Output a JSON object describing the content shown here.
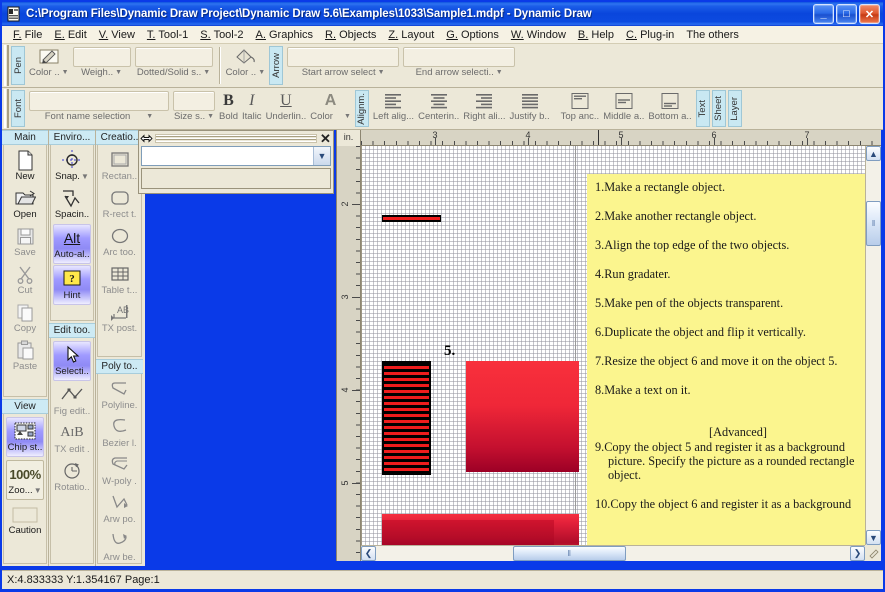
{
  "window": {
    "title": "C:\\Program Files\\Dynamic Draw Project\\Dynamic Draw 5.6\\Examples\\1033\\Sample1.mdpf - Dynamic Draw",
    "app_icon": "document-app-icon",
    "minimize": "_",
    "maximize": "□",
    "close": "✕"
  },
  "menubar": [
    {
      "accel": "F.",
      "label": "File"
    },
    {
      "accel": "E.",
      "label": "Edit"
    },
    {
      "accel": "V.",
      "label": "View"
    },
    {
      "accel": "T.",
      "label": "Tool-1"
    },
    {
      "accel": "S.",
      "label": "Tool-2"
    },
    {
      "accel": "A.",
      "label": "Graphics"
    },
    {
      "accel": "R.",
      "label": "Objects"
    },
    {
      "accel": "Z.",
      "label": "Layout"
    },
    {
      "accel": "G.",
      "label": "Options"
    },
    {
      "accel": "W.",
      "label": "Window"
    },
    {
      "accel": "B.",
      "label": "Help"
    },
    {
      "accel": "C.",
      "label": "Plug-in"
    },
    {
      "accel": "",
      "label": "The others"
    }
  ],
  "toolbar_pen": {
    "tab": "Pen",
    "items": [
      {
        "label": "Color ..",
        "icon": "pencil-icon",
        "dropdown": true
      },
      {
        "label": "Weigh..",
        "icon": "combo-box",
        "dropdown": true
      },
      {
        "label": "Dotted/Solid s..",
        "icon": "combo-box",
        "dropdown": true
      }
    ],
    "fill": {
      "label": "Color ..",
      "icon": "paint-bucket-icon",
      "dropdown": true
    }
  },
  "toolbar_arrow": {
    "tab": "Arrow",
    "items": [
      {
        "label": "Start arrow select",
        "icon": "combo-box",
        "dropdown": true
      },
      {
        "label": "End arrow selecti..",
        "icon": "combo-box",
        "dropdown": true
      }
    ]
  },
  "toolbar_font": {
    "tab": "Font",
    "name_label": "Font name selection",
    "size_label": "Size s..",
    "items": [
      {
        "label": "Bold",
        "glyph": "B",
        "style": "bold"
      },
      {
        "label": "Italic",
        "glyph": "I",
        "style": "italic"
      },
      {
        "label": "Underlin..",
        "glyph": "U",
        "style": "underline"
      },
      {
        "label": "Color",
        "glyph": "A",
        "dropdown": true
      }
    ]
  },
  "toolbar_align": {
    "tab": "Alignm.",
    "items": [
      {
        "label": "Left alig...",
        "icon": "align-left-icon"
      },
      {
        "label": "Centerin..",
        "icon": "align-center-icon"
      },
      {
        "label": "Right ali...",
        "icon": "align-right-icon"
      },
      {
        "label": "Justify b..",
        "icon": "align-justify-icon"
      },
      {
        "label": "Top anc..",
        "icon": "anchor-top-icon"
      },
      {
        "label": "Middle a..",
        "icon": "anchor-middle-icon"
      },
      {
        "label": "Bottom a..",
        "icon": "anchor-bottom-icon"
      }
    ],
    "tabs_right": [
      "Text",
      "Sheet",
      "Layer"
    ]
  },
  "dock": {
    "columns": [
      {
        "header": "Main",
        "items": [
          {
            "label": "New",
            "icon": "new-document-icon",
            "enabled": true
          },
          {
            "label": "Open",
            "icon": "open-folder-icon",
            "enabled": true
          },
          {
            "label": "Save",
            "icon": "floppy-disk-icon",
            "enabled": false
          },
          {
            "label": "Cut",
            "icon": "scissors-icon",
            "enabled": false
          },
          {
            "label": "Copy",
            "icon": "copy-icon",
            "enabled": false
          },
          {
            "label": "Paste",
            "icon": "clipboard-paste-icon",
            "enabled": false
          }
        ],
        "header2": "View",
        "items2": [
          {
            "label": "Chip st..",
            "icon": "chip-status-icon",
            "selected": true
          },
          {
            "label": "Zoo...",
            "icon": "zoom-icon",
            "value": "100%",
            "dropdown": true
          },
          {
            "label": "Caution",
            "icon": "caution-icon"
          }
        ]
      },
      {
        "header": "Enviro...",
        "items": [
          {
            "label": "Snap.",
            "icon": "snap-grid-icon",
            "dropdown": true
          },
          {
            "label": "Spacin..",
            "icon": "spacing-icon"
          },
          {
            "label": "Auto-al..",
            "icon": "alt-key-icon",
            "glyph": "Alt",
            "selected": true
          },
          {
            "label": "Hint",
            "icon": "hint-question-icon",
            "glyph": "?",
            "selected": true
          }
        ],
        "header2": "Edit too.",
        "items2": [
          {
            "label": "Selecti..",
            "icon": "cursor-arrow-icon",
            "selected": true
          },
          {
            "label": "Fig edit..",
            "icon": "figure-edit-icon"
          },
          {
            "label": "TX edit .",
            "icon": "text-edit-icon"
          },
          {
            "label": "Rotatio..",
            "icon": "rotation-icon"
          }
        ]
      },
      {
        "header": "Creatio..",
        "items": [
          {
            "label": "Rectan..",
            "icon": "rectangle-tool-icon"
          },
          {
            "label": "R-rect t.",
            "icon": "rounded-rectangle-tool-icon"
          },
          {
            "label": "Arc too.",
            "icon": "ellipse-arc-tool-icon"
          },
          {
            "label": "Table t...",
            "icon": "table-tool-icon"
          },
          {
            "label": "TX post.",
            "icon": "text-post-icon"
          }
        ],
        "header2": "Poly to..",
        "items2": [
          {
            "label": "Polyline.",
            "icon": "polyline-tool-icon"
          },
          {
            "label": "Bezier l.",
            "icon": "bezier-line-icon"
          },
          {
            "label": "W-poly .",
            "icon": "wide-polyline-icon"
          },
          {
            "label": "Arw po.",
            "icon": "arrow-polyline-icon"
          },
          {
            "label": "Arw be.",
            "icon": "arrow-bezier-icon"
          }
        ]
      }
    ]
  },
  "float_panel": {
    "name": "floating-tool-panel",
    "close_label": "✕",
    "combo_value": "",
    "combo_arrow": "▼"
  },
  "ruler": {
    "unit": "in.",
    "horizontal": [
      "3",
      "4",
      "5",
      "6",
      "7"
    ],
    "vertical": [
      "2",
      "3",
      "4",
      "5"
    ]
  },
  "canvas": {
    "shape_label": "5.",
    "shapes": [
      {
        "name": "thin-red-bar",
        "fill": "#ee1c1c",
        "stroke": "#000000"
      },
      {
        "name": "striped-black-red-rectangle",
        "fill": "#ee1c1c",
        "stroke": "#000000"
      },
      {
        "name": "gradient-red-rectangle-5",
        "fill_top": "#f8303c",
        "fill_bottom": "#9c0026"
      },
      {
        "name": "gradient-red-rectangle-6",
        "fill_top": "#f53040",
        "fill_bottom": "#9c0026"
      }
    ],
    "textbox_bg": "#fbf58e",
    "text_lines": [
      "1.Make a rectangle object.",
      "2.Make another rectangle object.",
      "3.Align the top edge of the two objects.",
      "4.Run gradater.",
      "5.Make pen of the objects transparent.",
      "6.Duplicate the object and flip it vertically.",
      "7.Resize the object 6 and move it on the object 5.",
      "8.Make a text on it."
    ],
    "advanced_header": "[Advanced]",
    "advanced_lines": [
      "9.Copy the object 5 and register it as a background picture. Specify the picture as a rounded rectangle object.",
      "10.Copy the object 6 and register it as a background"
    ]
  },
  "scrollbars": {
    "up": "▲",
    "down": "▼",
    "left": "❮",
    "right": "❯",
    "thumb_grip": "‖"
  },
  "statusbar": {
    "text": "X:4.833333 Y:1.354167 Page:1"
  }
}
